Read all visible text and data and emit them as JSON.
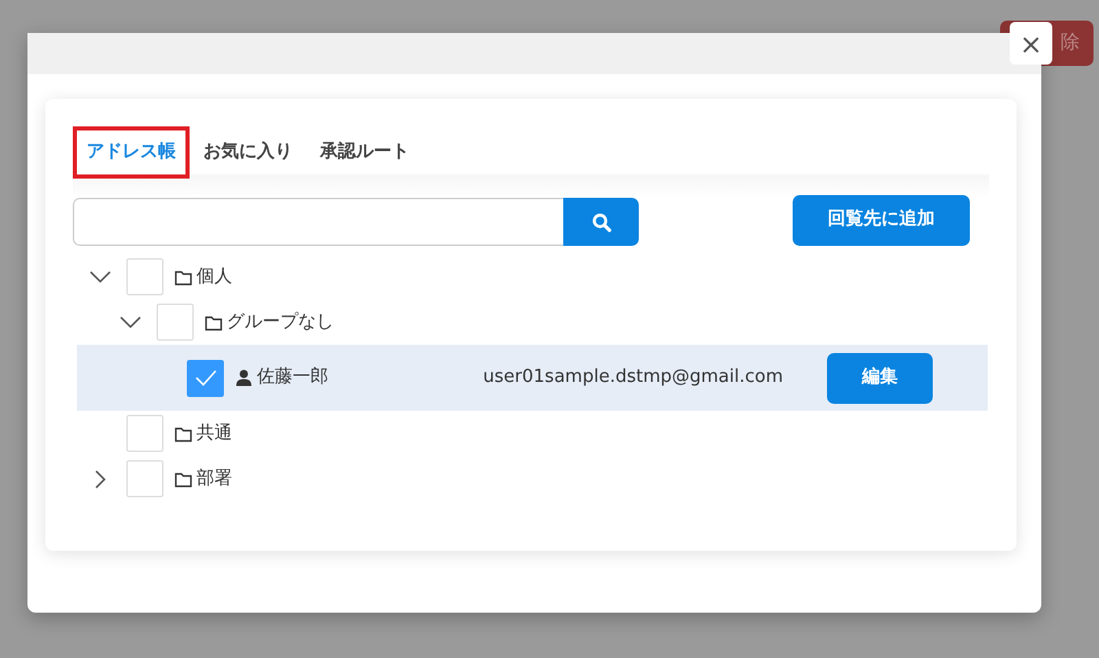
{
  "background": {
    "delete_button": "除"
  },
  "dialog": {
    "close": "×",
    "tabs": [
      {
        "label": "アドレス帳",
        "selected": true
      },
      {
        "label": "お気に入り",
        "selected": false
      },
      {
        "label": "承認ルート",
        "selected": false
      }
    ],
    "add_button": "回覧先に追加",
    "tree": [
      {
        "kind": "folder",
        "label": "個人",
        "expanded": true,
        "checked": false,
        "children": [
          {
            "kind": "folder",
            "label": "グループなし",
            "expanded": true,
            "checked": false,
            "children": [
              {
                "kind": "person",
                "label": "佐藤一郎",
                "email": "user01sample.dstmp@gmail.com",
                "action": "編集",
                "checked": true,
                "selected": true
              }
            ]
          }
        ]
      },
      {
        "kind": "folder",
        "label": "共通",
        "checked": false
      },
      {
        "kind": "folder",
        "label": "部署",
        "expanded": false,
        "checked": false
      }
    ]
  }
}
